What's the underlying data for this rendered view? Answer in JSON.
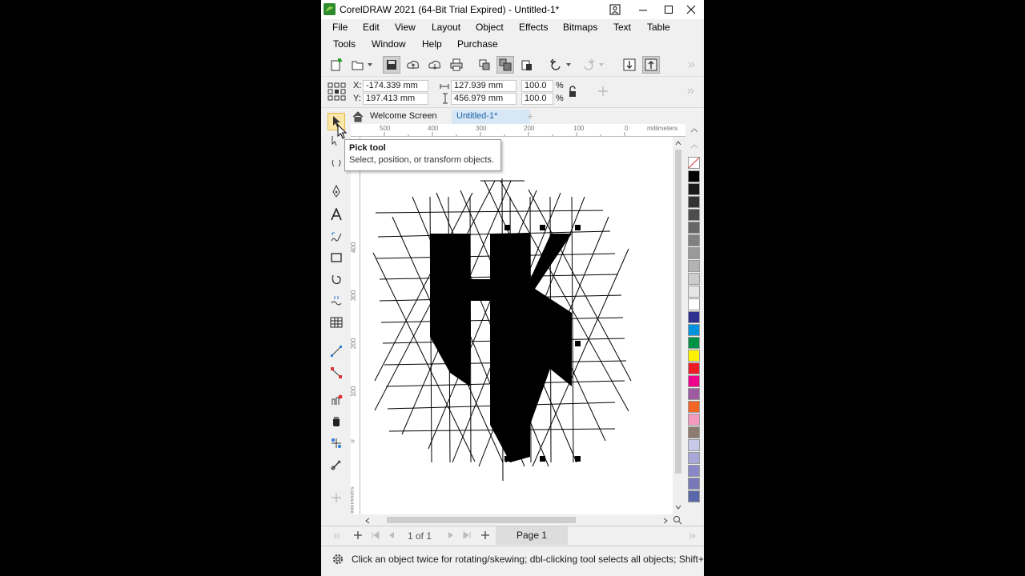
{
  "window": {
    "title": "CorelDRAW 2021 (64-Bit Trial Expired) - Untitled-1*",
    "buttons": [
      "minimize",
      "maximize",
      "close"
    ]
  },
  "menu": {
    "row1": [
      "File",
      "Edit",
      "View",
      "Layout",
      "Object",
      "Effects",
      "Bitmaps",
      "Text",
      "Table"
    ],
    "row2": [
      "Tools",
      "Window",
      "Help",
      "Purchase"
    ]
  },
  "propbar": {
    "x_label": "X:",
    "x_value": "-174.339 mm",
    "y_label": "Y:",
    "y_value": "197.413 mm",
    "width_value": "127.939 mm",
    "height_value": "456.979 mm",
    "scale_w": "100.0",
    "scale_h": "100.0",
    "percent": "%"
  },
  "tabs": {
    "welcome": "Welcome Screen",
    "document": "Untitled-1*",
    "add": "+"
  },
  "ruler": {
    "h_ticks": [
      "500",
      "400",
      "300",
      "200",
      "100",
      "0"
    ],
    "h_unit": "millimeters",
    "v_ticks": [
      "400",
      "300",
      "200",
      "100",
      "0"
    ],
    "v_unit": "millimeters"
  },
  "tooltip": {
    "title": "Pick tool",
    "description": "Select, position, or transform objects."
  },
  "artwork": {
    "letters": "HK"
  },
  "pagenav": {
    "page_count": "1 of 1",
    "page_tab": "Page 1"
  },
  "statusbar": {
    "message": "Click an object twice for rotating/skewing; dbl-clicking tool selects all objects; Shift+clic"
  },
  "palette": {
    "colors": [
      "#000000",
      "#1a1a1a",
      "#333333",
      "#4d4d4d",
      "#666666",
      "#808080",
      "#999999",
      "#b3b3b3",
      "#cccccc",
      "#e6e6e6",
      "#ffffff",
      "#2e3192",
      "#0093dd",
      "#009245",
      "#fff200",
      "#ed1c24",
      "#ec008c",
      "#a05a9f",
      "#f26522",
      "#f49ac1",
      "#8c7b6f",
      "#c8c8e8",
      "#a8a8d8",
      "#8888c8",
      "#7878b8",
      "#5868a8"
    ]
  },
  "accent": "#d7e7f5"
}
